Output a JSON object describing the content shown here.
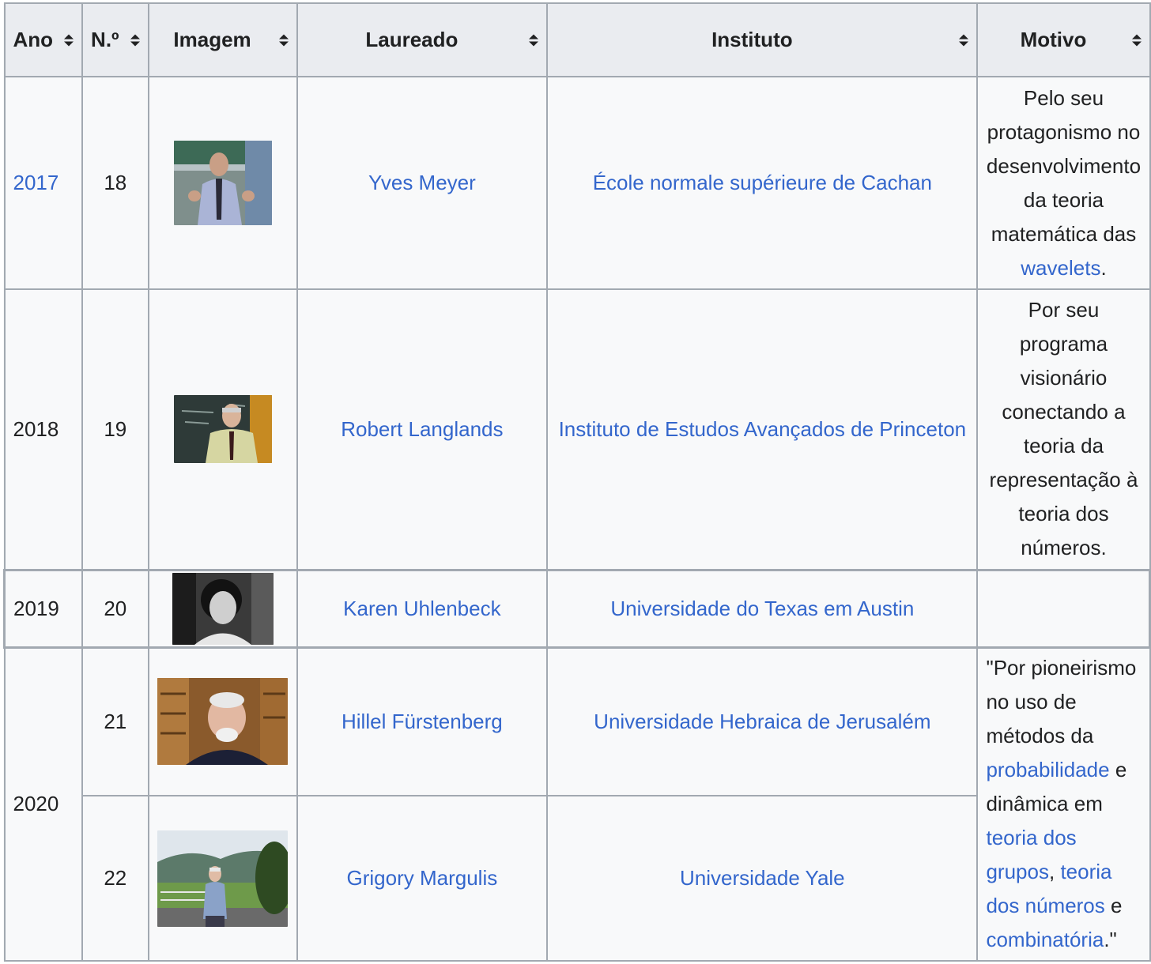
{
  "headers": {
    "year": "Ano",
    "number": "N.º",
    "image": "Imagem",
    "laureate": "Laureado",
    "institute": "Instituto",
    "reason": "Motivo"
  },
  "rows": [
    {
      "year": "2017",
      "number": "18",
      "laureate": "Yves Meyer",
      "institute": "École normale supérieure de Cachan",
      "reason_text": "Pelo seu protagonismo no desenvolvimento da teoria matemática das",
      "reason_link": "wavelets",
      "reason_end": "."
    },
    {
      "year": "2018",
      "number": "19",
      "laureate": "Robert Langlands",
      "institute": "Instituto de Estudos Avançados de Princeton",
      "reason_text": "Por seu programa visionário conectando a teoria da representação à teoria dos números."
    },
    {
      "year": "2019",
      "number": "20",
      "laureate": "Karen Uhlenbeck",
      "institute": "Universidade do Texas em Austin",
      "reason_text": ""
    },
    {
      "year": "2020",
      "number": "21",
      "laureate": "Hillel Fürstenberg",
      "institute": "Universidade Hebraica de Jerusalém"
    },
    {
      "number": "22",
      "laureate": "Grigory Margulis",
      "institute": "Universidade Yale"
    }
  ],
  "reason_2020": {
    "p1": "\"Por pioneirismo no uso de métodos da",
    "link1": "probabilidade",
    "p2": "e dinâmica em",
    "link2": "teoria dos grupos",
    "p3": ",",
    "link3": "teoria dos números",
    "p4": "e",
    "link4": "combinatória",
    "p5": ".\""
  },
  "colors": {
    "link": "#3366cc",
    "border": "#a2a9b1",
    "header_bg": "#eaecf0",
    "cell_bg": "#f8f9fa"
  }
}
